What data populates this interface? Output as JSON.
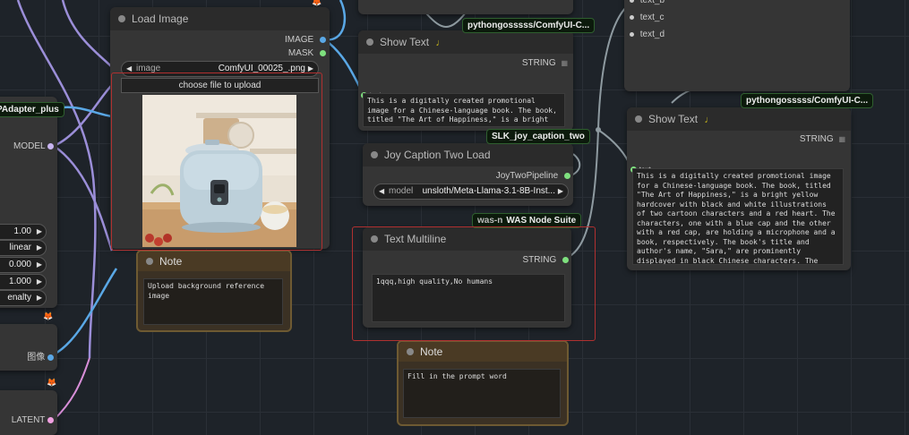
{
  "load_image": {
    "title": "Load Image",
    "out_image": "IMAGE",
    "out_mask": "MASK",
    "image_label": "image",
    "image_value": "ComfyUI_00025_.png",
    "upload_button": "choose file to upload"
  },
  "show_text_top": {
    "badge": "pythongosssss/ComfyUI-C...",
    "title": "Show Text",
    "type_label": "STRING",
    "input_label": "text",
    "text": "This is a digitally created promotional image for a Chinese-language book. The book, titled \"The Art of Happiness,\" is a bright yellow hardcover with black and white illustrations of two cartoon"
  },
  "joy_caption": {
    "badge": "SLK_joy_caption_two",
    "title": "Joy Caption Two Load",
    "output": "JoyTwoPipeline",
    "model_label": "model",
    "model_value": "unsloth/Meta-Llama-3.1-8B-Inst..."
  },
  "text_multiline": {
    "badge": "WAS Node Suite",
    "badge_prefix": "was-n",
    "title": "Text Multiline",
    "type_label": "STRING",
    "text": "1qqq,high quality,No humans"
  },
  "note_image": {
    "title": "Note",
    "text": "Upload background reference image"
  },
  "note_prompt": {
    "title": "Note",
    "text": "Fill in the prompt word"
  },
  "right_top": {
    "slots": [
      "text_b",
      "text_c",
      "text_d"
    ]
  },
  "show_text_right": {
    "badge": "pythongosssss/ComfyUI-C...",
    "title": "Show Text",
    "type_label": "STRING",
    "input_label": "text",
    "text": "This is a digitally created promotional image for a Chinese-language book. The book, titled \"The Art of Happiness,\" is a bright yellow hardcover with black and white illustrations of two cartoon characters and a red heart. The characters, one with a blue cap and the other with a red cap, are holding a microphone and a book, respectively. The book's title and author's name, \"Sara,\" are prominently displayed in black Chinese characters. The background features a green chalkboard with white Chinese text promoting the book. The overall design is colorful and playful, with a cheerful and"
  },
  "left_panel": {
    "adapter_label": "PAdapter_plus",
    "model_label": "MODEL",
    "values": [
      "1.00",
      "linear",
      "0.000",
      "1.000",
      "enalty"
    ],
    "image_cn": "图像",
    "latent": "LATENT"
  },
  "colors": {
    "canvas": "#1e2329",
    "node": "#353535",
    "wire_purple": "#9b8ed8",
    "wire_blue": "#5aa8e6",
    "wire_gray": "#8e9aa0",
    "slot_green": "#7ee07e",
    "highlight_red": "#b03030"
  }
}
